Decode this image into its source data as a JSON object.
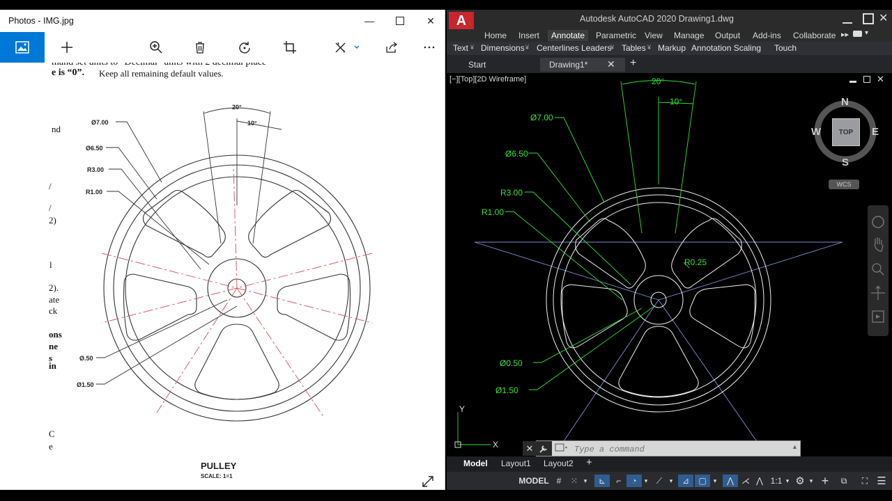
{
  "photos": {
    "title": "Photos - IMG.jpg",
    "doc": {
      "line1": "mand set units to \"Decimal\" units with 2 decimal place",
      "line2a": "e is “0”.",
      "line2b": "Keep all remaining default values.",
      "margin_fragments": [
        "nd",
        "/",
        "/",
        "2)",
        "l",
        "2).",
        "ate",
        "ck",
        "ons",
        "ne",
        "s",
        "in",
        "C",
        "e"
      ],
      "labels": {
        "d700": "Ø7.00",
        "d650": "Ø6.50",
        "r300": "R3.00",
        "r100": "R1.00",
        "d050": "Ø.50",
        "d150": "Ø1.50",
        "a20": "20°",
        "a10": "10°"
      },
      "caption_title": "PULLEY",
      "caption_scale": "SCALE:  1=1"
    }
  },
  "autocad": {
    "title": "Autodesk AutoCAD 2020    Drawing1.dwg",
    "logo_letter": "A",
    "ribbon_tabs": [
      "Home",
      "Insert",
      "Annotate",
      "Parametric",
      "View",
      "Manage",
      "Output",
      "Add-ins",
      "Collaborate"
    ],
    "active_tab": "Annotate",
    "panels": [
      "Text",
      "Dimensions",
      "Centerlines",
      "Leaders",
      "Tables",
      "Markup",
      "Annotation Scaling",
      "Touch"
    ],
    "doc_tabs": [
      "Start",
      "Drawing1*"
    ],
    "viewport_label": "[−][Top][2D Wireframe]",
    "viewcube": {
      "n": "N",
      "s": "S",
      "e": "E",
      "w": "W",
      "face": "TOP",
      "wcs": "WCS"
    },
    "dims": {
      "a20": "20°",
      "a10": "10°",
      "d700": "Ø7.00",
      "d650": "Ø6.50",
      "r300": "R3.00",
      "r100": "R1.00",
      "r025": "R0.25",
      "d050": "Ø0.50",
      "d150": "Ø1.50"
    },
    "ucs": {
      "x": "X",
      "y": "Y"
    },
    "command_placeholder": "Type a command",
    "layout_tabs": [
      "Model",
      "Layout1",
      "Layout2"
    ],
    "status": {
      "model": "MODEL",
      "scale": "1:1"
    },
    "colors": {
      "dim": "#33e633",
      "centerline": "#7b8fd6",
      "geometry": "#ffffff",
      "logo": "#c8252c"
    }
  }
}
